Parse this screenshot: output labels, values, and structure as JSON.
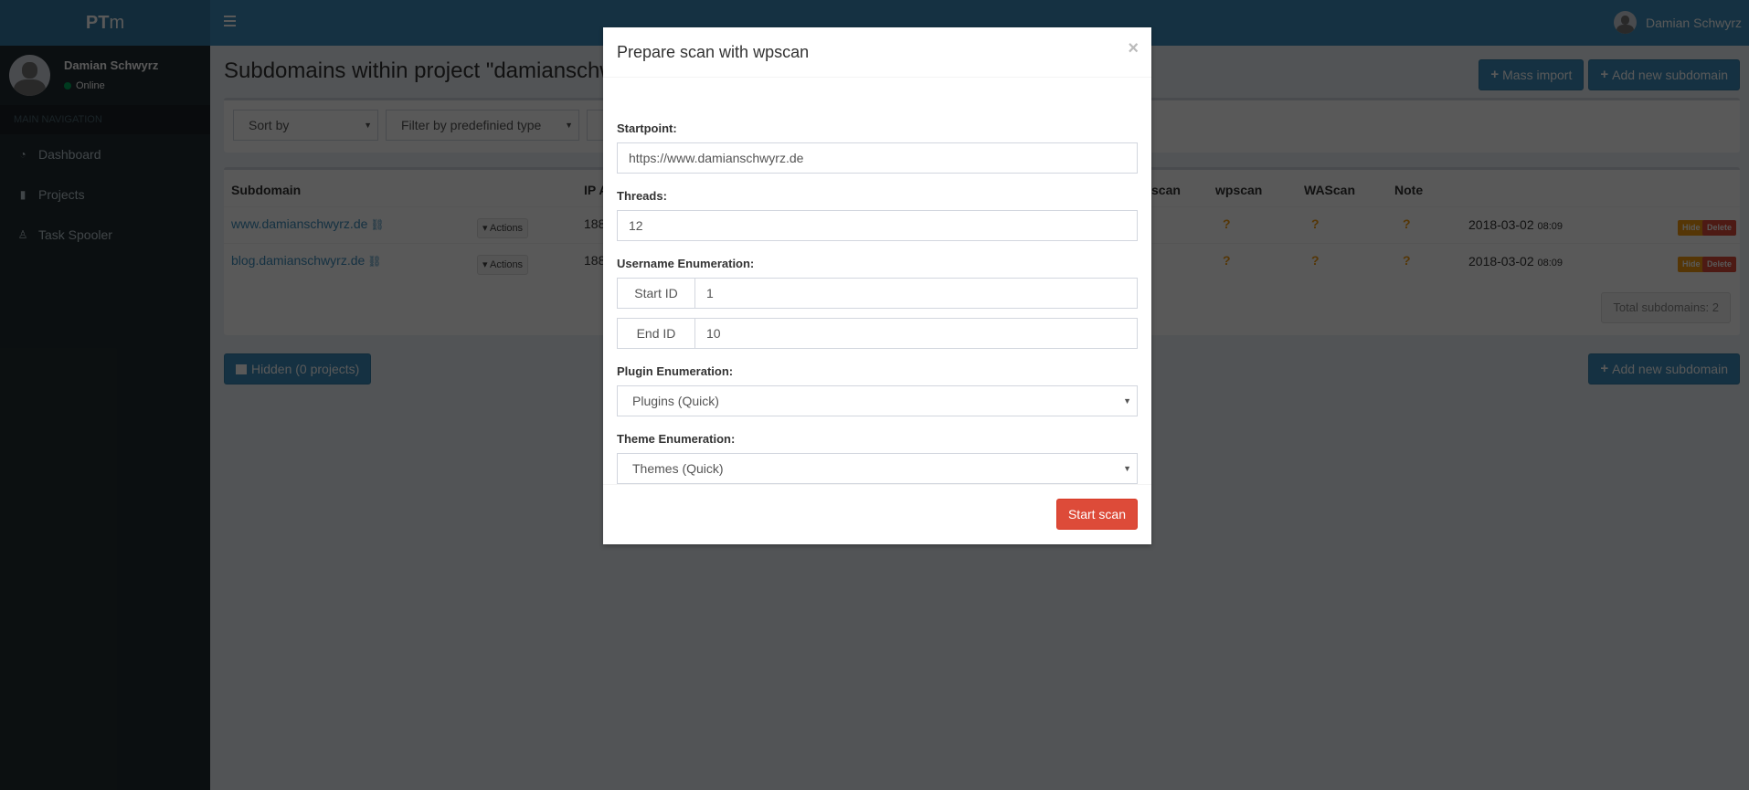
{
  "app": {
    "logo_bold": "PT",
    "logo_rest": "m"
  },
  "navbar": {
    "user_name": "Damian Schwyrz"
  },
  "sidebar": {
    "user_name": "Damian Schwyrz",
    "status": "Online",
    "section_header": "MAIN NAVIGATION",
    "items": [
      {
        "label": "Dashboard",
        "icon": "dashboard-icon",
        "glyph": "◔"
      },
      {
        "label": "Projects",
        "icon": "file-icon",
        "glyph": "▮"
      },
      {
        "label": "Task Spooler",
        "icon": "linux-icon",
        "glyph": "♙"
      }
    ]
  },
  "main": {
    "title": "Subdomains within project \"damianschwyrz.de\"",
    "buttons": {
      "mass_import": "Mass import",
      "add_new_subdomain": "Add new subdomain",
      "hidden": "Hidden (0 projects)"
    },
    "filters": {
      "sort_by": "Sort by",
      "filter_type": "Filter by predefinied type"
    },
    "table": {
      "headers": {
        "subdomain": "Subdomain",
        "ip": "IP Address",
        "partial_scan": "scan",
        "wpscan": "wpscan",
        "wascan": "WAScan",
        "note": "Note"
      },
      "rows": [
        {
          "subdomain": "www.damianschwyrz.de",
          "actions": "Actions",
          "ip": "188",
          "wpscan": "?",
          "wascan": "?",
          "note": "?",
          "date": "2018-03-02",
          "time": "08:09",
          "hide": "Hide",
          "delete": "Delete"
        },
        {
          "subdomain": "blog.damianschwyrz.de",
          "actions": "Actions",
          "ip": "188",
          "wpscan": "?",
          "wascan": "?",
          "note": "?",
          "date": "2018-03-02",
          "time": "08:09",
          "hide": "Hide",
          "delete": "Delete"
        }
      ],
      "total": "Total subdomains: 2"
    }
  },
  "modal": {
    "title": "Prepare scan with wpscan",
    "close": "×",
    "startpoint_label": "Startpoint:",
    "startpoint_value": "https://www.damianschwyrz.de",
    "threads_label": "Threads:",
    "threads_value": "12",
    "username_label": "Username Enumeration:",
    "start_id_label": "Start ID",
    "start_id_value": "1",
    "end_id_label": "End ID",
    "end_id_value": "10",
    "plugin_label": "Plugin Enumeration:",
    "plugin_value": "Plugins (Quick)",
    "theme_label": "Theme Enumeration:",
    "theme_value": "Themes (Quick)",
    "start_button": "Start scan"
  }
}
